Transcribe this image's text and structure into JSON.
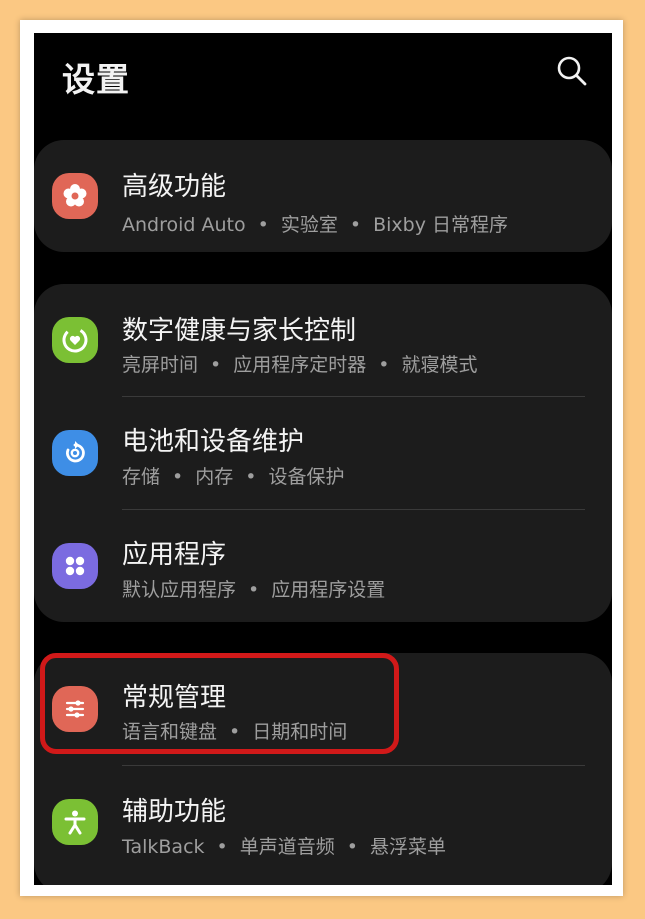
{
  "header": {
    "title": "设置"
  },
  "groups": [
    {
      "items": [
        {
          "label": "高级功能",
          "sub": [
            "Android Auto",
            "实验室",
            "Bixby 日常程序"
          ],
          "icon": "advanced-features-icon",
          "color": "#e06757"
        }
      ]
    },
    {
      "items": [
        {
          "label": "数字健康与家长控制",
          "sub": [
            "亮屏时间",
            "应用程序定时器",
            "就寝模式"
          ],
          "icon": "digital-wellbeing-icon",
          "color": "#7bc034"
        },
        {
          "label": "电池和设备维护",
          "sub": [
            "存储",
            "内存",
            "设备保护"
          ],
          "icon": "device-care-icon",
          "color": "#3e8ee6"
        },
        {
          "label": "应用程序",
          "sub": [
            "默认应用程序",
            "应用程序设置"
          ],
          "icon": "apps-icon",
          "color": "#7b6be0"
        }
      ]
    },
    {
      "items": [
        {
          "label": "常规管理",
          "sub": [
            "语言和键盘",
            "日期和时间"
          ],
          "icon": "general-management-icon",
          "color": "#e06757"
        },
        {
          "label": "辅助功能",
          "sub": [
            "TalkBack",
            "单声道音频",
            "悬浮菜单"
          ],
          "icon": "accessibility-icon",
          "color": "#7bc034"
        }
      ]
    }
  ]
}
